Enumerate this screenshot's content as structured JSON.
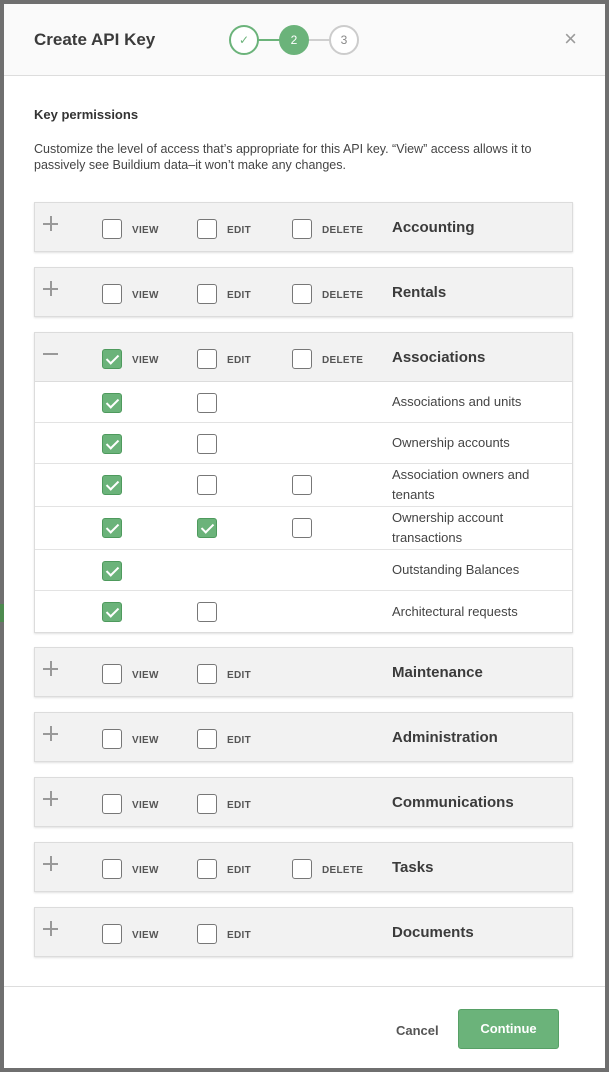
{
  "dialog": {
    "title": "Create API Key",
    "steps": [
      "✓",
      "2",
      "3"
    ],
    "close": "×"
  },
  "section": {
    "title": "Key permissions",
    "description": "Customize the level of access that’s appropriate for this API key. “View” access allows it to passively see Buildium data–it won’t make any changes."
  },
  "labels": {
    "view": "VIEW",
    "edit": "EDIT",
    "delete": "DELETE"
  },
  "categories": [
    {
      "name": "Accounting",
      "expanded": false,
      "view": false,
      "edit": false,
      "delete": false,
      "has_delete": true
    },
    {
      "name": "Rentals",
      "expanded": false,
      "view": false,
      "edit": false,
      "delete": false,
      "has_delete": true
    },
    {
      "name": "Associations",
      "expanded": true,
      "view": true,
      "edit": false,
      "delete": false,
      "has_delete": true,
      "items": [
        {
          "name": "Associations and units",
          "view": true,
          "edit": false
        },
        {
          "name": "Ownership accounts",
          "view": true,
          "edit": false
        },
        {
          "name": "Association owners and tenants",
          "view": true,
          "edit": false,
          "delete": false
        },
        {
          "name": "Ownership account transactions",
          "view": true,
          "edit": true,
          "delete": false
        },
        {
          "name": "Outstanding Balances",
          "view": true
        },
        {
          "name": "Architectural requests",
          "view": true,
          "edit": false
        }
      ]
    },
    {
      "name": "Maintenance",
      "expanded": false,
      "view": false,
      "edit": false,
      "has_delete": false
    },
    {
      "name": "Administration",
      "expanded": false,
      "view": false,
      "edit": false,
      "has_delete": false
    },
    {
      "name": "Communications",
      "expanded": false,
      "view": false,
      "edit": false,
      "has_delete": false
    },
    {
      "name": "Tasks",
      "expanded": false,
      "view": false,
      "edit": false,
      "delete": false,
      "has_delete": true
    },
    {
      "name": "Documents",
      "expanded": false,
      "view": false,
      "edit": false,
      "has_delete": false
    }
  ],
  "footer": {
    "cancel": "Cancel",
    "continue": "Continue"
  },
  "colors": {
    "accent": "#6bb37a",
    "card_bg": "#f2f2f2"
  }
}
